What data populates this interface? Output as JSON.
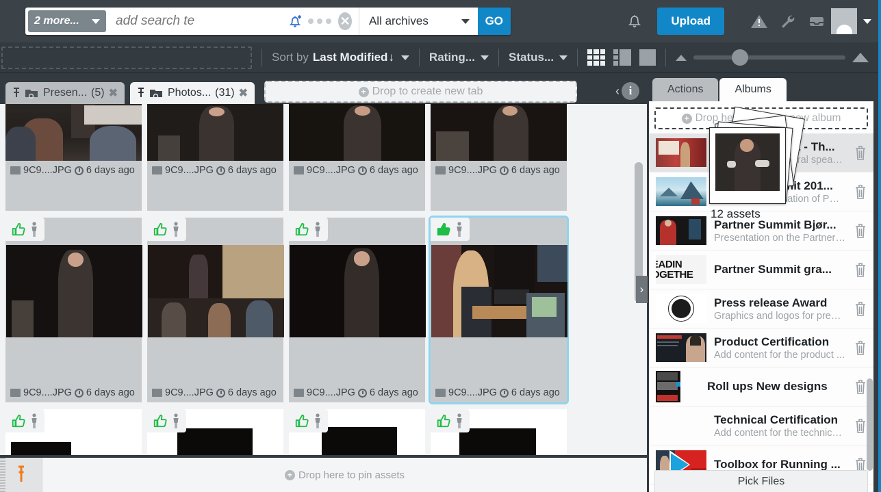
{
  "search": {
    "filter_chip": "2 more...",
    "placeholder": "add search te",
    "value": "",
    "bell_icon": "bell-plus-icon",
    "dots_icon": "ellipsis-icon",
    "clear_icon": "clear-circle-icon",
    "archive_select": "All archives",
    "go_label": "GO"
  },
  "topright": {
    "notifications_icon": "bell-icon",
    "upload_label": "Upload",
    "alert_icon": "warning-triangle-icon",
    "tools_icon": "wrench-icon",
    "inbox_icon": "inbox-icon",
    "avatar_icon": "user-avatar",
    "avatar_caret": "chevron-down-icon"
  },
  "sortbar": {
    "drop_zone": "",
    "sort_by_label": "Sort by",
    "sort_by_value": "Last Modified",
    "sort_direction": "↓",
    "rating_label": "Rating...",
    "status_label": "Status...",
    "view_grid_icon": "grid-view-icon",
    "view_split_icon": "split-view-icon",
    "view_single_icon": "single-view-icon",
    "zoom_min_icon": "zoom-small-icon",
    "zoom_max_icon": "zoom-large-icon",
    "zoom_value": "18"
  },
  "tabs": [
    {
      "pin": "pin-icon",
      "folder": "folder-search-icon",
      "label": "Presen...",
      "count": "(5)",
      "close": "✖",
      "active": false
    },
    {
      "pin": "pin-icon",
      "folder": "folder-search-icon",
      "label": "Photos...",
      "count": "(31)",
      "close": "✖",
      "active": true
    }
  ],
  "new_tab_dropzone": "Drop to create new tab",
  "info_button": {
    "chevron": "‹",
    "glyph": "i"
  },
  "grid": {
    "row1": [
      {
        "filename": "9C9....JPG",
        "modified": "6 days ago",
        "selected": false,
        "approved": false
      },
      {
        "filename": "9C9....JPG",
        "modified": "6 days ago",
        "selected": false,
        "approved": false
      },
      {
        "filename": "9C9....JPG",
        "modified": "6 days ago",
        "selected": false,
        "approved": false
      },
      {
        "filename": "9C9....JPG",
        "modified": "6 days ago",
        "selected": false,
        "approved": false
      }
    ],
    "row2": [
      {
        "filename": "9C9....JPG",
        "modified": "6 days ago",
        "selected": false,
        "approved": true
      },
      {
        "filename": "9C9....JPG",
        "modified": "6 days ago",
        "selected": false,
        "approved": true
      },
      {
        "filename": "9C9....JPG",
        "modified": "6 days ago",
        "selected": false,
        "approved": true
      },
      {
        "filename": "9C9....JPG",
        "modified": "6 days ago",
        "selected": true,
        "approved": true
      }
    ],
    "row3": [
      {
        "approved": true
      },
      {
        "approved": true
      },
      {
        "approved": true
      },
      {
        "approved": true
      }
    ]
  },
  "pinbar": {
    "pin_icon": "pushpin-icon",
    "drop_label": "Drop here to pin assets"
  },
  "rightpanel": {
    "tabs": [
      {
        "label": "Actions",
        "active": false
      },
      {
        "label": "Albums",
        "active": true
      }
    ],
    "drop_album_label": "Drop here to create new album",
    "albums": [
      {
        "title": "Partner Summit - Th...",
        "desc": "Photos of the general speaker ...",
        "highlight": true,
        "has_thumb": true
      },
      {
        "title": "Partner Summit 201...",
        "desc": "The best combination of PDFs...",
        "highlight": false,
        "has_thumb": true
      },
      {
        "title": "Partner Summit Bjør...",
        "desc": "Presentation on the Partner ...",
        "highlight": false,
        "has_thumb": true
      },
      {
        "title": "Partner Summit gra...",
        "desc": "",
        "highlight": false,
        "has_thumb": true
      },
      {
        "title": "Press release Award",
        "desc": "Graphics and logos for press...",
        "highlight": false,
        "has_thumb": true
      },
      {
        "title": "Product Certification",
        "desc": "Add content for the product ...",
        "highlight": false,
        "has_thumb": true
      },
      {
        "title": "Roll ups New designs",
        "desc": "",
        "highlight": false,
        "has_thumb": true
      },
      {
        "title": "Technical Certification",
        "desc": "Add content for the technica...",
        "highlight": false,
        "has_thumb": false
      },
      {
        "title": "Toolbox for Running ...",
        "desc": "",
        "highlight": false,
        "has_thumb": true
      }
    ],
    "pick_files_label": "Pick Files"
  },
  "drag_ghost": {
    "label": "12 assets"
  },
  "colors": {
    "accent_blue": "#1287c8",
    "chrome_dark": "#3b4248",
    "chrome_darker": "#333a40",
    "selection_blue": "#8fd4ef",
    "approve_green": "#1fbd46",
    "pin_orange": "#f07c18"
  }
}
